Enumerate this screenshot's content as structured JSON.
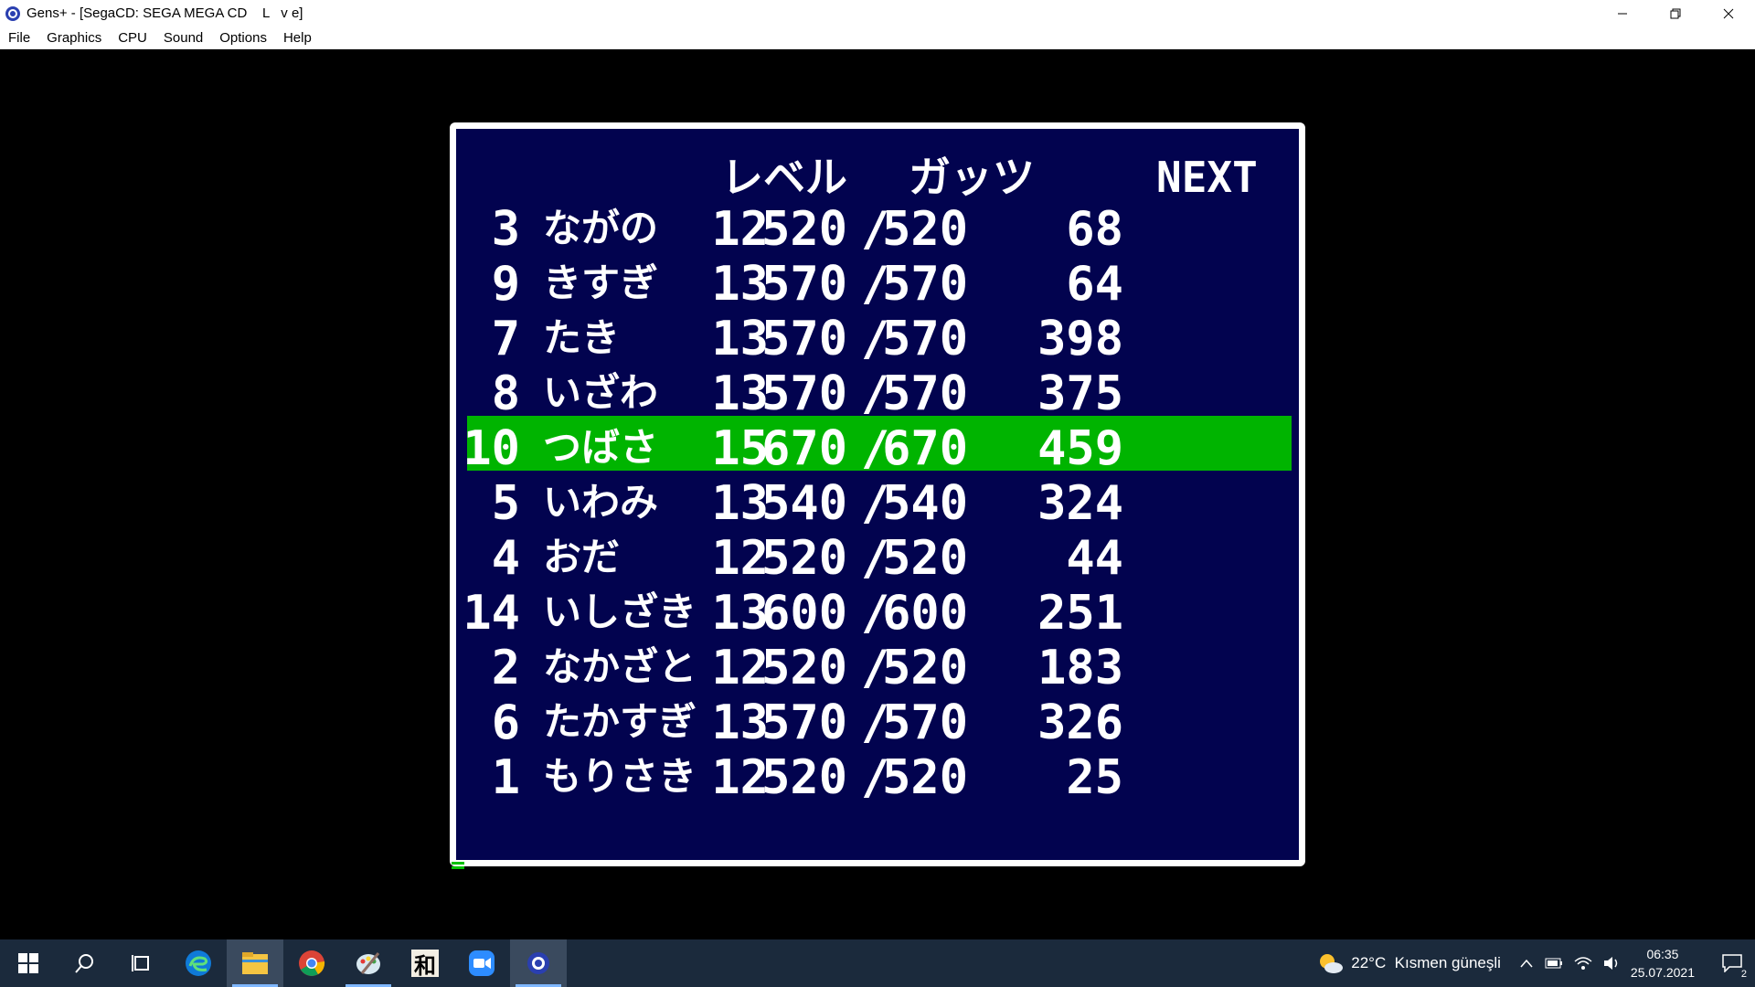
{
  "window": {
    "title": "Gens+ - [SegaCD: SEGA MEGA CD    L   v e]",
    "minimize_label": "—",
    "restore_label": "❐",
    "close_label": "✕"
  },
  "menu": [
    "File",
    "Graphics",
    "CPU",
    "Sound",
    "Options",
    "Help"
  ],
  "game": {
    "headers": {
      "level": "レベル",
      "guts": "ガッツ",
      "next": "NEXT"
    },
    "rows": [
      {
        "no": "3",
        "name": "ながの",
        "level": "12",
        "cur": "520",
        "sep": "/",
        "max": "520",
        "next": "68",
        "selected": false
      },
      {
        "no": "9",
        "name": "きすぎ",
        "level": "13",
        "cur": "570",
        "sep": "/",
        "max": "570",
        "next": "64",
        "selected": false
      },
      {
        "no": "7",
        "name": "たき",
        "level": "13",
        "cur": "570",
        "sep": "/",
        "max": "570",
        "next": "398",
        "selected": false
      },
      {
        "no": "8",
        "name": "いざわ",
        "level": "13",
        "cur": "570",
        "sep": "/",
        "max": "570",
        "next": "375",
        "selected": false
      },
      {
        "no": "10",
        "name": "つばさ",
        "level": "15",
        "cur": "670",
        "sep": "/",
        "max": "670",
        "next": "459",
        "selected": true
      },
      {
        "no": "5",
        "name": "いわみ",
        "level": "13",
        "cur": "540",
        "sep": "/",
        "max": "540",
        "next": "324",
        "selected": false
      },
      {
        "no": "4",
        "name": "おだ",
        "level": "12",
        "cur": "520",
        "sep": "/",
        "max": "520",
        "next": "44",
        "selected": false
      },
      {
        "no": "14",
        "name": "いしざき",
        "level": "13",
        "cur": "600",
        "sep": "/",
        "max": "600",
        "next": "251",
        "selected": false
      },
      {
        "no": "2",
        "name": "なかざと",
        "level": "12",
        "cur": "520",
        "sep": "/",
        "max": "520",
        "next": "183",
        "selected": false
      },
      {
        "no": "6",
        "name": "たかすぎ",
        "level": "13",
        "cur": "570",
        "sep": "/",
        "max": "570",
        "next": "326",
        "selected": false
      },
      {
        "no": "1",
        "name": "もりさき",
        "level": "12",
        "cur": "520",
        "sep": "/",
        "max": "520",
        "next": "25",
        "selected": false
      }
    ],
    "panel_color": "#02034f",
    "highlight_color": "#00b400"
  },
  "taskbar": {
    "apps": [
      "windows-start-icon",
      "search-icon",
      "task-view-icon",
      "edge-icon",
      "file-explorer-icon",
      "chrome-icon",
      "paint-icon",
      "kanji-app-icon",
      "zoom-icon",
      "gens-icon"
    ],
    "kanji_label": "和",
    "weather": "22°C  Kısmen güneşli",
    "time": "06:35",
    "date": "25.07.2021",
    "notifications": "2"
  }
}
